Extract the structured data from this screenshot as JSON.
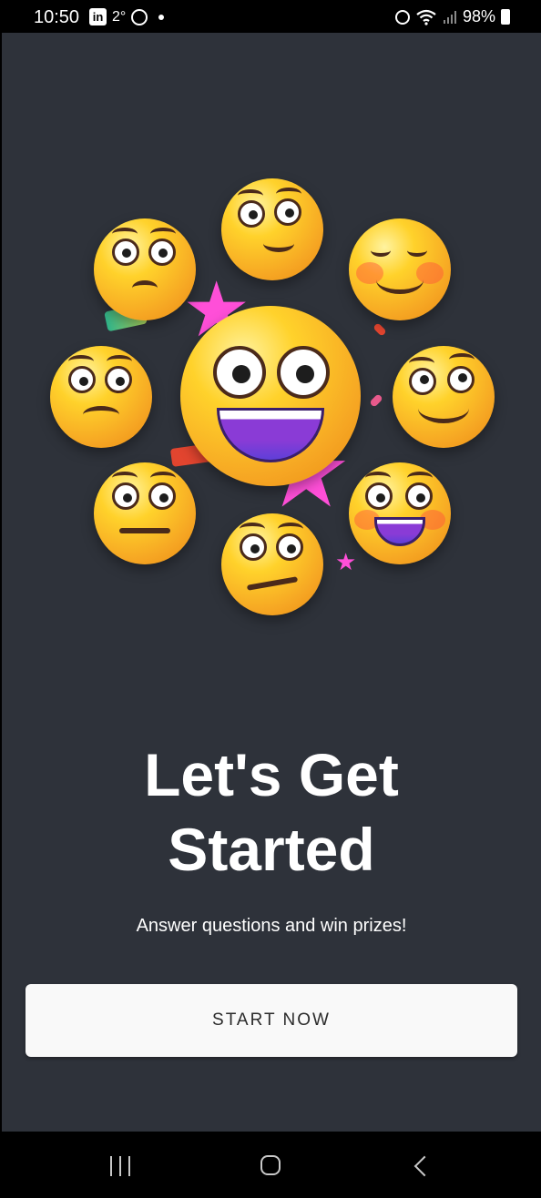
{
  "status_bar": {
    "time": "10:50",
    "linkedin_label": "in",
    "temperature": "2°",
    "battery": "98%",
    "icons": [
      "linkedin-icon",
      "whatsapp-icon",
      "notification-dot-icon",
      "alarm-icon",
      "wifi-icon",
      "signal-icon",
      "battery-charging-icon"
    ]
  },
  "hero": {
    "illustration": "emoji-faces-collage"
  },
  "main": {
    "title_line1": "Let's Get",
    "title_line2": "Started",
    "subtitle": "Answer questions and win prizes!",
    "start_button_label": "START NOW"
  },
  "nav_bar": {
    "icons": [
      "recents-icon",
      "home-icon",
      "back-icon"
    ]
  },
  "colors": {
    "background": "#2e323a",
    "button_bg": "#f9f9f9",
    "title_text": "#ffffff",
    "accent_star": "#ff4fd8"
  }
}
